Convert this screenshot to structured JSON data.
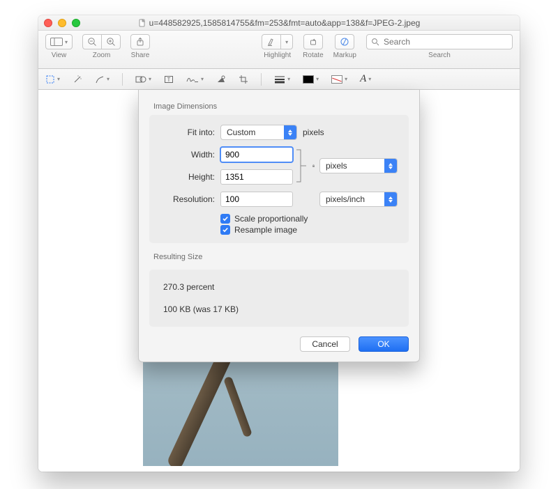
{
  "window": {
    "filename": "u=448582925,1585814755&fm=253&fmt=auto&app=138&f=JPEG-2.jpeg"
  },
  "toolbar": {
    "view_label": "View",
    "zoom_label": "Zoom",
    "share_label": "Share",
    "highlight_label": "Highlight",
    "rotate_label": "Rotate",
    "markup_label": "Markup",
    "search_label": "Search",
    "search_placeholder": "Search"
  },
  "sheet": {
    "section_dimensions": "Image Dimensions",
    "fit_into_label": "Fit into:",
    "fit_into_value": "Custom",
    "fit_into_unit": "pixels",
    "width_label": "Width:",
    "width_value": "900",
    "height_label": "Height:",
    "height_value": "1351",
    "dim_unit_value": "pixels",
    "resolution_label": "Resolution:",
    "resolution_value": "100",
    "resolution_unit_value": "pixels/inch",
    "scale_label": "Scale proportionally",
    "resample_label": "Resample image",
    "section_result": "Resulting Size",
    "result_percent": "270.3 percent",
    "result_bytes": "100 KB (was 17 KB)",
    "cancel_label": "Cancel",
    "ok_label": "OK"
  }
}
